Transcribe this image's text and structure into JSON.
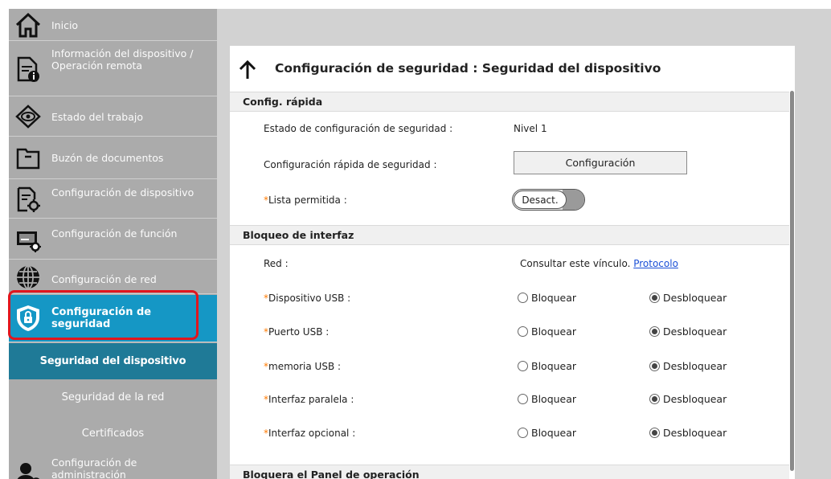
{
  "sidebar": {
    "items": [
      {
        "label": "Inicio",
        "icon": "home-icon"
      },
      {
        "label": "Información del dispositivo / Operación remota",
        "icon": "device-info-icon"
      },
      {
        "label": "Estado del trabajo",
        "icon": "eye-icon"
      },
      {
        "label": "Buzón de documentos",
        "icon": "folder-icon"
      },
      {
        "label": "Configuración de dispositivo",
        "icon": "device-settings-icon"
      },
      {
        "label": "Configuración de función",
        "icon": "function-settings-icon"
      },
      {
        "label": "Configuración de red",
        "icon": "globe-icon"
      },
      {
        "label": "Configuración de seguridad",
        "icon": "shield-icon"
      },
      {
        "label": "Configuración de administración",
        "icon": "admin-icon"
      }
    ],
    "subitems": [
      {
        "label": "Seguridad del dispositivo"
      },
      {
        "label": "Seguridad de la red"
      },
      {
        "label": "Certificados"
      }
    ]
  },
  "page": {
    "title": "Configuración de seguridad : Seguridad del dispositivo"
  },
  "quick": {
    "header": "Config. rápida",
    "status_label": "Estado de configuración de seguridad :",
    "status_value": "Nivel 1",
    "quick_label": "Configuración rápida de seguridad :",
    "quick_button": "Configuración",
    "allow_label": "Lista permitida :",
    "allow_toggle": "Desact."
  },
  "interface": {
    "header": "Bloqueo de interfaz",
    "network_label": "Red :",
    "network_text": "Consultar este vínculo.",
    "network_link": "Protocolo",
    "lock_option": "Bloquear",
    "unlock_option": "Desbloquear",
    "rows": [
      {
        "label": "Dispositivo USB :",
        "selected": "Desbloquear"
      },
      {
        "label": "Puerto USB :",
        "selected": "Desbloquear"
      },
      {
        "label": "memoria USB :",
        "selected": "Desbloquear"
      },
      {
        "label": "Interfaz paralela :",
        "selected": "Desbloquear"
      },
      {
        "label": "Interfaz opcional :",
        "selected": "Desbloquear"
      }
    ]
  },
  "panel_lock": {
    "header": "Bloquera el Panel de operación"
  },
  "required_marker": "*",
  "colors": {
    "sidebar_bg": "#ababab",
    "active_item": "#1597c5",
    "active_subitem": "#1f7a97",
    "highlight_border": "#e0161e",
    "required_marker": "#ff7a00",
    "link": "#1a4fd6"
  }
}
